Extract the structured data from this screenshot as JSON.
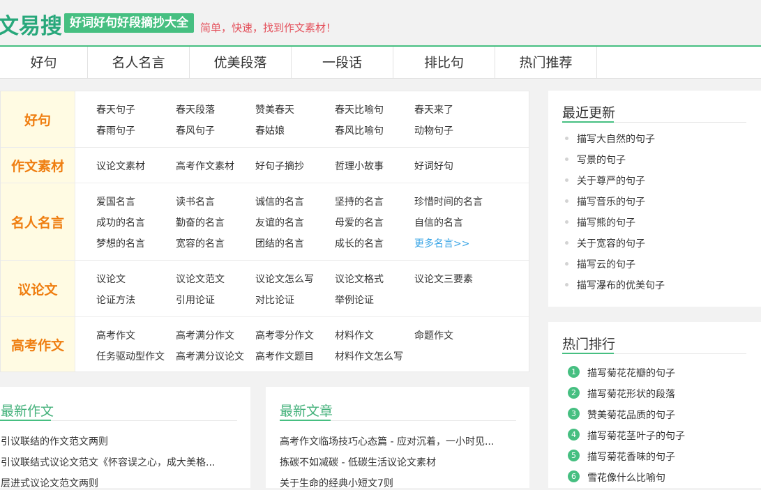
{
  "header": {
    "logo": "文易搜",
    "badge": "好词好句好段摘抄大全",
    "slogan": "简单，快速，找到作文素材！"
  },
  "nav": [
    "好句",
    "名人名言",
    "优美段落",
    "一段话",
    "排比句",
    "热门推荐"
  ],
  "categories": [
    {
      "name": "好句",
      "links": [
        [
          "春天句子",
          "春天段落",
          "赞美春天",
          "春天比喻句",
          "春天来了"
        ],
        [
          "春雨句子",
          "春风句子",
          "春姑娘",
          "春风比喻句",
          "动物句子"
        ]
      ]
    },
    {
      "name": "作文素材",
      "links": [
        [
          "议论文素材",
          "高考作文素材",
          "好句子摘抄",
          "哲理小故事",
          "好词好句"
        ]
      ]
    },
    {
      "name": "名人名言",
      "links": [
        [
          "爱国名言",
          "读书名言",
          "诚信的名言",
          "坚持的名言",
          "珍惜时间的名言"
        ],
        [
          "成功的名言",
          "勤奋的名言",
          "友谊的名言",
          "母爱的名言",
          "自信的名言"
        ],
        [
          "梦想的名言",
          "宽容的名言",
          "团结的名言",
          "成长的名言",
          "更多名言>>"
        ]
      ]
    },
    {
      "name": "议论文",
      "links": [
        [
          "议论文",
          "议论文范文",
          "议论文怎么写",
          "议论文格式",
          "议论文三要素"
        ],
        [
          "论证方法",
          "引用论证",
          "对比论证",
          "举例论证"
        ]
      ]
    },
    {
      "name": "高考作文",
      "links": [
        [
          "高考作文",
          "高考满分作文",
          "高考零分作文",
          "材料作文",
          "命题作文"
        ],
        [
          "任务驱动型作文",
          "高考满分议论文",
          "高考作文题目",
          "材料作文怎么写"
        ]
      ]
    }
  ],
  "latest_essays": {
    "title": "最新作文",
    "items": [
      "引议联结的作文范文两则",
      "引议联结式议论文范文《怀容误之心，成大美格...",
      "层进式议论文范文两则"
    ]
  },
  "latest_articles": {
    "title": "最新文章",
    "items": [
      "高考作文临场技巧心态篇 - 应对沉着，一小时见...",
      "拣碳不如减碳 - 低碳生活议论文素材",
      "关于生命的经典小短文7则"
    ]
  },
  "recent_updates": {
    "title": "最近更新",
    "items": [
      "描写大自然的句子",
      "写景的句子",
      "关于尊严的句子",
      "描写音乐的句子",
      "描写熊的句子",
      "关于宽容的句子",
      "描写云的句子",
      "描写瀑布的优美句子"
    ]
  },
  "hot_ranking": {
    "title": "热门排行",
    "items": [
      {
        "rank": "1",
        "text": "描写菊花花瓣的句子"
      },
      {
        "rank": "2",
        "text": "描写菊花形状的段落"
      },
      {
        "rank": "3",
        "text": "赞美菊花品质的句子"
      },
      {
        "rank": "4",
        "text": "描写菊花茎叶子的句子"
      },
      {
        "rank": "5",
        "text": "描写菊花香味的句子"
      },
      {
        "rank": "6",
        "text": "雪花像什么比喻句"
      }
    ]
  },
  "colors": {
    "accent": "#46bf81",
    "category_title": "#ef7e11",
    "slogan": "#e4515c",
    "more_link": "#3aa5e6"
  }
}
